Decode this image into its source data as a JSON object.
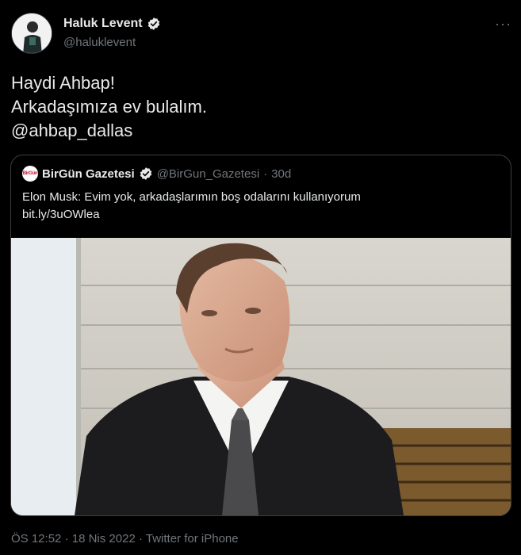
{
  "author": {
    "display_name": "Haluk Levent",
    "handle": "@haluklevent"
  },
  "menu": {
    "more_label": "···"
  },
  "tweet": {
    "lines": [
      "Haydi Ahbap!",
      "Arkadaşımıza ev bulalım.",
      "@ahbap_dallas"
    ]
  },
  "quote": {
    "logo_text": "BirGün",
    "display_name": "BirGün Gazetesi",
    "handle": "@BirGun_Gazetesi",
    "separator": "·",
    "time": "30d",
    "text_line1": "Elon Musk: Evim yok, arkadaşlarımın boş odalarını kullanıyorum",
    "link": "bit.ly/3uOWlea"
  },
  "footer": {
    "time": "ÖS 12:52",
    "sep1": "·",
    "date": "18 Nis 2022",
    "sep2": "·",
    "source": "Twitter for iPhone"
  },
  "colors": {
    "background": "#000000",
    "text": "#e7e9ea",
    "muted": "#71767b",
    "verified": "#e7e9ea",
    "border": "#3a3d41"
  },
  "icons": {
    "verified": "verified-badge-icon",
    "more": "more-options-icon"
  }
}
